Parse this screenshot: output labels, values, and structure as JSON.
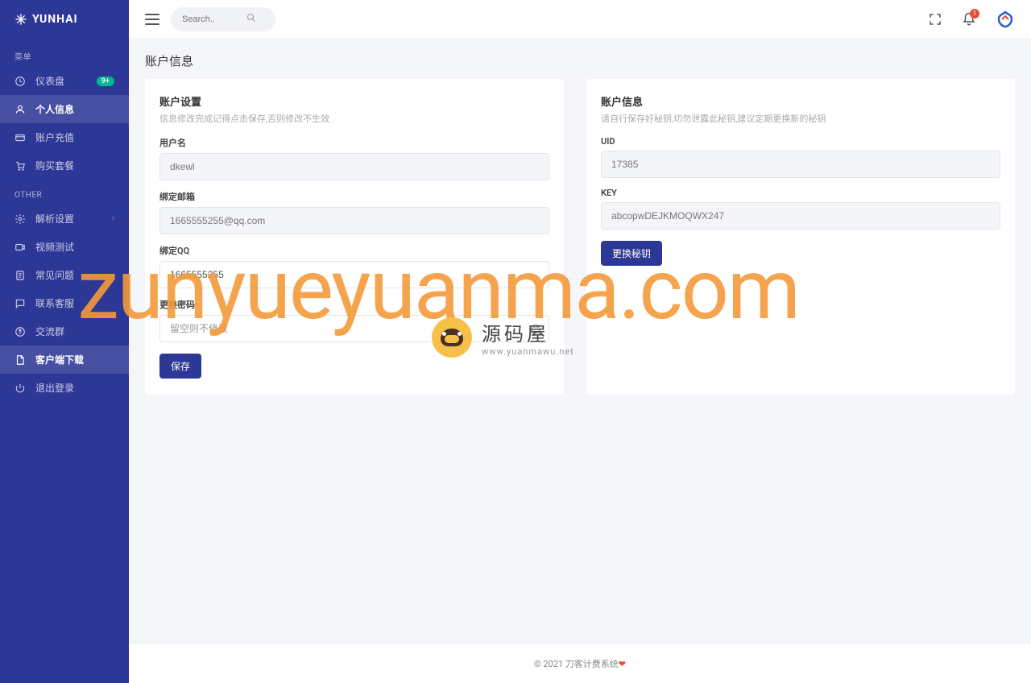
{
  "brand": "YUNHAI",
  "search": {
    "placeholder": "Search.."
  },
  "notif_count": "1",
  "sidebar": {
    "section1": "菜单",
    "section2": "OTHER",
    "items": [
      {
        "label": "仪表盘",
        "badge": "9+"
      },
      {
        "label": "个人信息"
      },
      {
        "label": "账户充值"
      },
      {
        "label": "购买套餐"
      },
      {
        "label": "解析设置"
      },
      {
        "label": "视频测试"
      },
      {
        "label": "常见问题"
      },
      {
        "label": "联系客服"
      },
      {
        "label": "交流群"
      },
      {
        "label": "客户端下载"
      },
      {
        "label": "退出登录"
      }
    ]
  },
  "page_title": "账户信息",
  "left_card": {
    "title": "账户设置",
    "sub": "信息修改完成记得点击保存,否则修改不生效",
    "username_label": "用户名",
    "username_value": "dkewl",
    "email_label": "绑定邮箱",
    "email_value": "1665555255@qq.com",
    "qq_label": "绑定QQ",
    "qq_value": "1665555255",
    "pwd_label": "更换密码",
    "pwd_placeholder": "留空则不修改",
    "save_btn": "保存"
  },
  "right_card": {
    "title": "账户信息",
    "sub": "请自行保存好秘钥,切勿泄露此秘钥,建议定期更换新的秘钥",
    "uid_label": "UID",
    "uid_value": "17385",
    "key_label": "KEY",
    "key_value": "abcopwDEJKMOQWX247",
    "change_btn": "更换秘钥"
  },
  "footer": "© 2021 刀客计费系统",
  "watermark": {
    "text": "zunyueyuanma.com",
    "cn": "源码屋",
    "url": "www.yuanmawu.net"
  }
}
